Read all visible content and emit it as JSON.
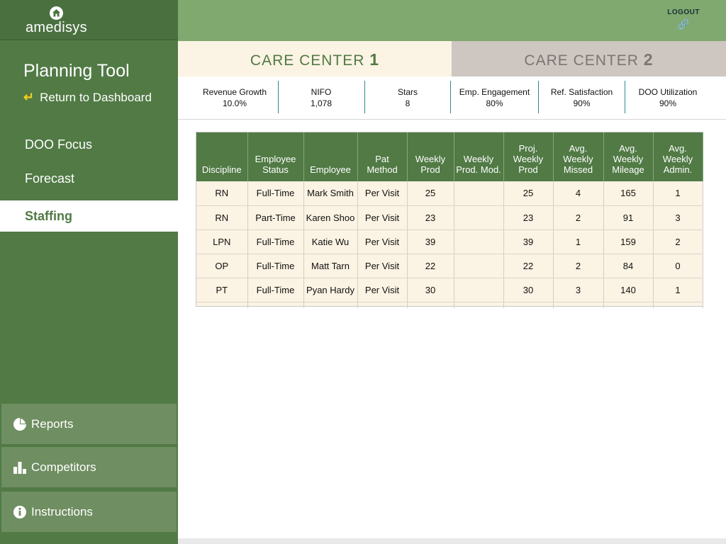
{
  "brand": {
    "name": "amedisys"
  },
  "sidebar": {
    "title": "Planning Tool",
    "return_label": "Return to Dashboard",
    "nav": [
      {
        "label": "DOO Focus",
        "active": false
      },
      {
        "label": "Forecast",
        "active": false
      },
      {
        "label": "Staffing",
        "active": true
      }
    ],
    "tools": [
      {
        "label": "Reports",
        "icon": "pie-chart-icon"
      },
      {
        "label": "Competitors",
        "icon": "bar-chart-icon"
      },
      {
        "label": "Instructions",
        "icon": "info-icon"
      }
    ]
  },
  "header": {
    "logout_label": "LOGOUT",
    "logout_icon": "link-icon"
  },
  "tabs": [
    {
      "label": "CARE CENTER",
      "number": "1",
      "active": true
    },
    {
      "label": "CARE CENTER",
      "number": "2",
      "active": false
    }
  ],
  "metrics": [
    {
      "label": "Revenue Growth",
      "value": "10.0%"
    },
    {
      "label": "NIFO",
      "value": "1,078"
    },
    {
      "label": "Stars",
      "value": "8"
    },
    {
      "label": "Emp. Engagement",
      "value": "80%"
    },
    {
      "label": "Ref. Satisfaction",
      "value": "90%"
    },
    {
      "label": "DOO Utilization",
      "value": "90%"
    }
  ],
  "table": {
    "headers": [
      "Discipline",
      "Employee Status",
      "Employee",
      "Pat Method",
      "Weekly Prod",
      "Weekly Prod. Mod.",
      "Proj. Weekly Prod",
      "Avg. Weekly Missed",
      "Avg. Weekly Mileage",
      "Avg. Weekly Admin."
    ],
    "rows": [
      [
        "RN",
        "Full-Time",
        "Mark Smith",
        "Per Visit",
        "25",
        "",
        "25",
        "4",
        "165",
        "1"
      ],
      [
        "RN",
        "Part-Time",
        "Karen Shoo",
        "Per Visit",
        "23",
        "",
        "23",
        "2",
        "91",
        "3"
      ],
      [
        "LPN",
        "Full-Time",
        "Katie Wu",
        "Per Visit",
        "39",
        "",
        "39",
        "1",
        "159",
        "2"
      ],
      [
        "OP",
        "Full-Time",
        "Matt Tarn",
        "Per Visit",
        "22",
        "",
        "22",
        "2",
        "84",
        "0"
      ],
      [
        "PT",
        "Full-Time",
        "Pyan Hardy",
        "Per Visit",
        "30",
        "",
        "30",
        "3",
        "140",
        "1"
      ]
    ]
  },
  "colors": {
    "sidebar": "#517a45",
    "topbar": "#7fa96f",
    "tab_active_bg": "#fbf3e3",
    "tab_inactive_bg": "#cec6c0",
    "accent_yellow": "#f4cf1c",
    "divider_teal": "#2c8a8e"
  }
}
